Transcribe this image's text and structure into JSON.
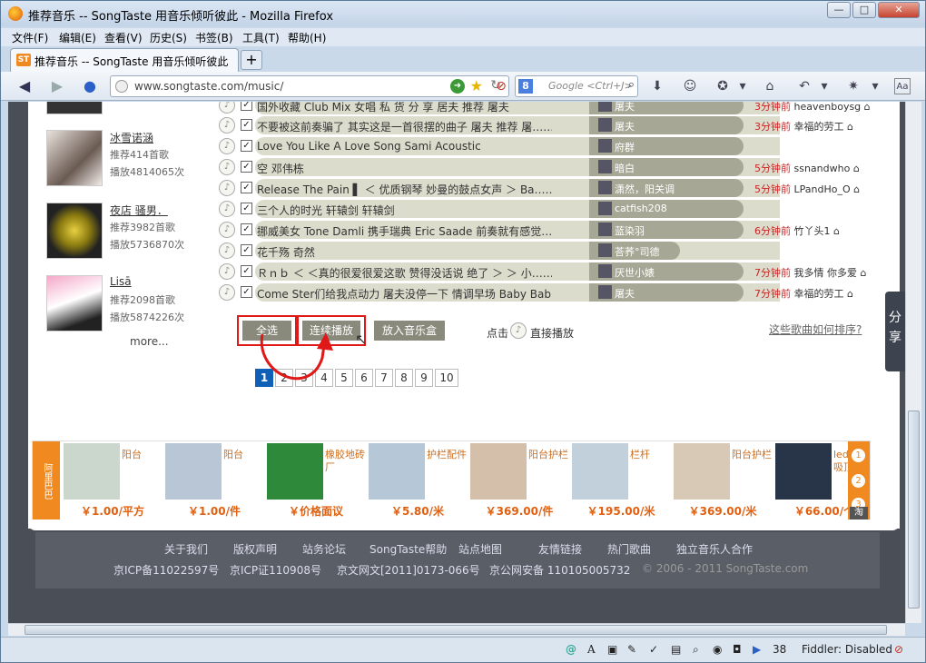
{
  "window": {
    "title": "推荐音乐 -- SongTaste 用音乐倾听彼此 - Mozilla Firefox",
    "btn_min": "—",
    "btn_max": "□",
    "btn_close": "✕"
  },
  "menu": [
    "文件(F)",
    "编辑(E)",
    "查看(V)",
    "历史(S)",
    "书签(B)",
    "工具(T)",
    "帮助(H)"
  ],
  "tab": {
    "favicon": "ST",
    "label": "推荐音乐 -- SongTaste 用音乐倾听彼此",
    "new_tab": "+"
  },
  "nav": {
    "url": "www.songtaste.com/music/",
    "search_engine": "8",
    "search_placeholder": "Google <Ctrl+J>"
  },
  "users": [
    {
      "name": "冰雪诺涵",
      "songs": "推荐414首歌",
      "plays": "播放4814065次"
    },
    {
      "name": "夜店 骚男．",
      "songs": "推荐3982首歌",
      "plays": "播放5736870次"
    },
    {
      "name": "Lisā",
      "songs": "推荐2098首歌",
      "plays": "播放5874226次"
    }
  ],
  "more_link": "more...",
  "songs": [
    {
      "title": "国外收藏 Club Mix 女唱 私 货 分 享 居夫 推荐 屠夫",
      "recommender": "屠夫",
      "time": "3分钟前",
      "user": "heavenboysg",
      "arrow": "⌂"
    },
    {
      "title": "不要被这前奏骗了 其实这是一首很摆的曲子 屠夫 推荐 屠……",
      "recommender": "屠夫",
      "time": "3分钟前",
      "user": "幸福的劳工",
      "arrow": "⌂"
    },
    {
      "title": "Love You Like A Love Song Sami Acoustic",
      "recommender": "府群",
      "time": "",
      "user": "",
      "arrow": ""
    },
    {
      "title": "空 邓伟栋",
      "recommender": "暗白",
      "time": "5分钟前",
      "user": "ssnandwho",
      "arrow": "⌂"
    },
    {
      "title": "Release The Pain ▌ ＜ 优质钢琴 妙曼的鼓点女声 ＞ Ba……",
      "recommender": "潇然，阳关调",
      "time": "5分钟前",
      "user": "LPandHo_O",
      "arrow": "⌂"
    },
    {
      "title": "三个人的时光 轩辕剑 轩辕剑",
      "recommender": "catfish208",
      "time": "",
      "user": "",
      "arrow": ""
    },
    {
      "title": "挪威美女 Tone Damli 携手瑞典 Eric Saade 前奏就有感觉……",
      "recommender": "蓝染羽",
      "time": "6分钟前",
      "user": "竹丫头1",
      "arrow": "⌂"
    },
    {
      "title": "花千殇 奇然",
      "recommender": "荅荞°司德",
      "time": "",
      "user": "",
      "arrow": ""
    },
    {
      "title": "Ｒｎｂ ＜ ＜真的很爱很爱这歌 赞得没话说 绝了 ＞ ＞ 小……",
      "recommender": "厌世小婊",
      "time": "7分钟前",
      "user": "我多情 你多爱",
      "arrow": "⌂"
    },
    {
      "title": "Come Ster们给我点动力 屠夫没停一下 情调早场 Baby Bab……",
      "recommender": "屠夫",
      "time": "7分钟前",
      "user": "幸福的劳工",
      "arrow": "⌂"
    }
  ],
  "actions": {
    "select_all": "全选",
    "continuous_play": "连续播放",
    "add_to_box": "放入音乐盒",
    "hint_click": "点击",
    "hint_direct": "直接播放",
    "sort_link": "这些歌曲如何排序?"
  },
  "pages": [
    "1",
    "2",
    "3",
    "4",
    "5",
    "6",
    "7",
    "8",
    "9",
    "10"
  ],
  "ads": {
    "brand": "阿里巴巴",
    "items": [
      {
        "name": "阳台",
        "price": "￥1.00/平方"
      },
      {
        "name": "阳台",
        "price": "￥1.00/件"
      },
      {
        "name": "橡胶地砖厂",
        "price": "￥价格面议"
      },
      {
        "name": "护栏配件",
        "price": "￥5.80/米"
      },
      {
        "name": "阳台护栏",
        "price": "￥369.00/件"
      },
      {
        "name": "栏杆",
        "price": "￥195.00/米"
      },
      {
        "name": "阳台护栏",
        "price": "￥369.00/米"
      },
      {
        "name": "led圆形吸顶灯",
        "price": "￥66.00/个"
      }
    ],
    "side_nums": [
      "1",
      "2",
      "3"
    ],
    "side_tag": "淘"
  },
  "share": "分享",
  "footer": {
    "links": [
      "关于我们",
      "版权声明",
      "站务论坛",
      "SongTaste帮助",
      "站点地图",
      "友情链接",
      "热门歌曲",
      "独立音乐人合作"
    ],
    "icp": [
      "京ICP备11022597号",
      "京ICP证110908号",
      "京文网文[2011]0173-066号",
      "京公网安备 110105005732"
    ],
    "copyright": "© 2006 - 2011 SongTaste.com"
  },
  "status": {
    "count": "38",
    "fiddler": "Fiddler: Disabled"
  },
  "colors": {
    "accent": "#1160b8",
    "highlight": "#e01818",
    "ad_orange": "#f08a20"
  }
}
